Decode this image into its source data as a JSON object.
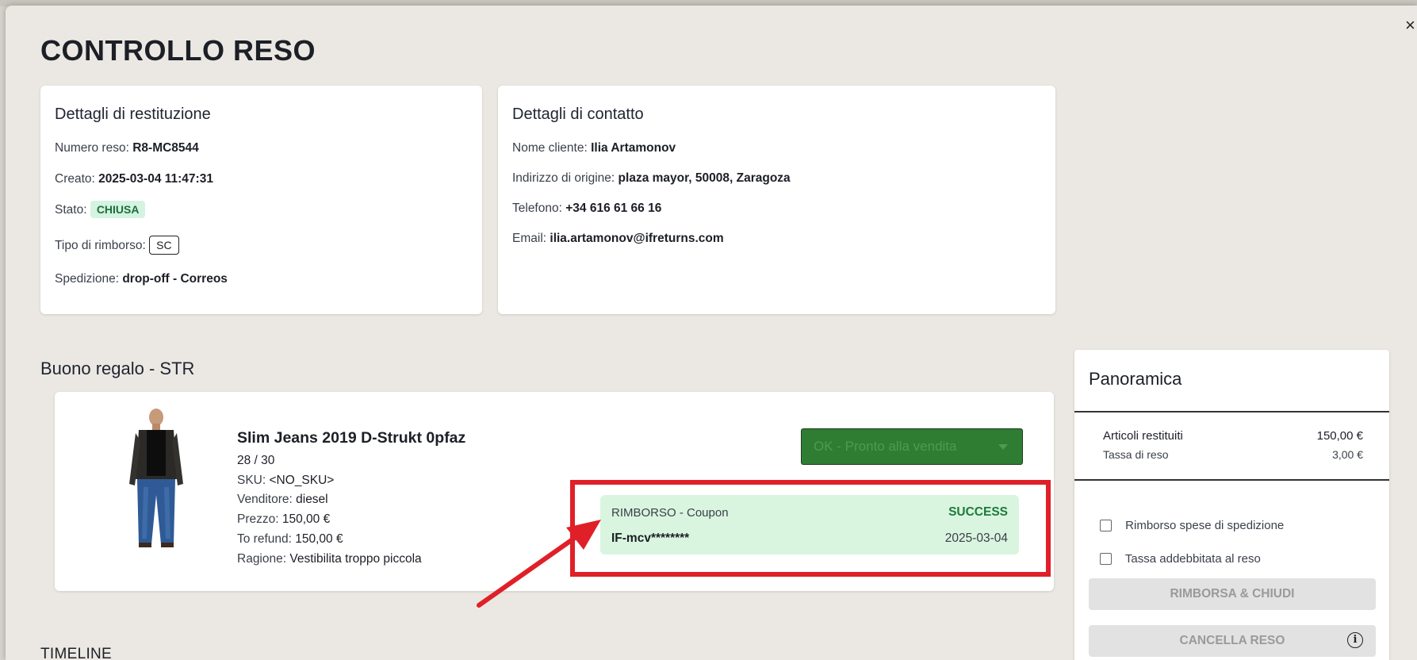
{
  "page": {
    "title": "CONTROLLO RESO",
    "close_symbol": "×"
  },
  "return_details": {
    "heading": "Dettagli di restituzione",
    "number_label": "Numero reso:",
    "number_value": "R8-MC8544",
    "created_label": "Creato:",
    "created_value": "2025-03-04 11:47:31",
    "status_label": "Stato:",
    "status_value": "CHIUSA",
    "refund_type_label": "Tipo di rimborso:",
    "refund_type_value": "SC",
    "shipping_label": "Spedizione:",
    "shipping_value": "drop-off - Correos"
  },
  "contact_details": {
    "heading": "Dettagli di contatto",
    "name_label": "Nome cliente:",
    "name_value": "Ilia Artamonov",
    "address_label": "Indirizzo di origine:",
    "address_value": "plaza mayor, 50008, Zaragoza",
    "phone_label": "Telefono:",
    "phone_value": "+34 616 61 66 16",
    "email_label": "Email:",
    "email_value": "ilia.artamonov@ifreturns.com"
  },
  "gift_section": {
    "title": "Buono regalo - STR"
  },
  "product": {
    "name": "Slim Jeans 2019 D-Strukt 0pfaz",
    "size": "28 / 30",
    "sku_label": "SKU:",
    "sku_value": "<NO_SKU>",
    "seller_label": "Venditore:",
    "seller_value": "diesel",
    "price_label": "Prezzo:",
    "price_value": "150,00 €",
    "to_refund_label": "To refund:",
    "to_refund_value": "150,00 €",
    "reason_label": "Ragione:",
    "reason_value": "Vestibilita troppo piccola",
    "condition_select": "OK - Pronto alla vendita"
  },
  "refund": {
    "type": "RIMBORSO - Coupon",
    "status": "SUCCESS",
    "code": "IF-mcv********",
    "date": "2025-03-04"
  },
  "overview": {
    "title": "Panoramica",
    "returned_items_label": "Articoli restituiti",
    "returned_items_value": "150,00 €",
    "return_fee_label": "Tassa di reso",
    "return_fee_value": "3,00 €",
    "shipping_refund_label": "Rimborso spese di spedizione",
    "fee_charged_label": "Tassa addebbitata al reso",
    "refund_close_button": "RIMBORSA & CHIUDI",
    "cancel_button": "CANCELLA RESO",
    "info_symbol": "i"
  },
  "timeline": {
    "title": "TIMELINE"
  },
  "colors": {
    "highlight": "#e02028",
    "success": "#1d7a3a",
    "select_bg": "#2e7d32"
  }
}
